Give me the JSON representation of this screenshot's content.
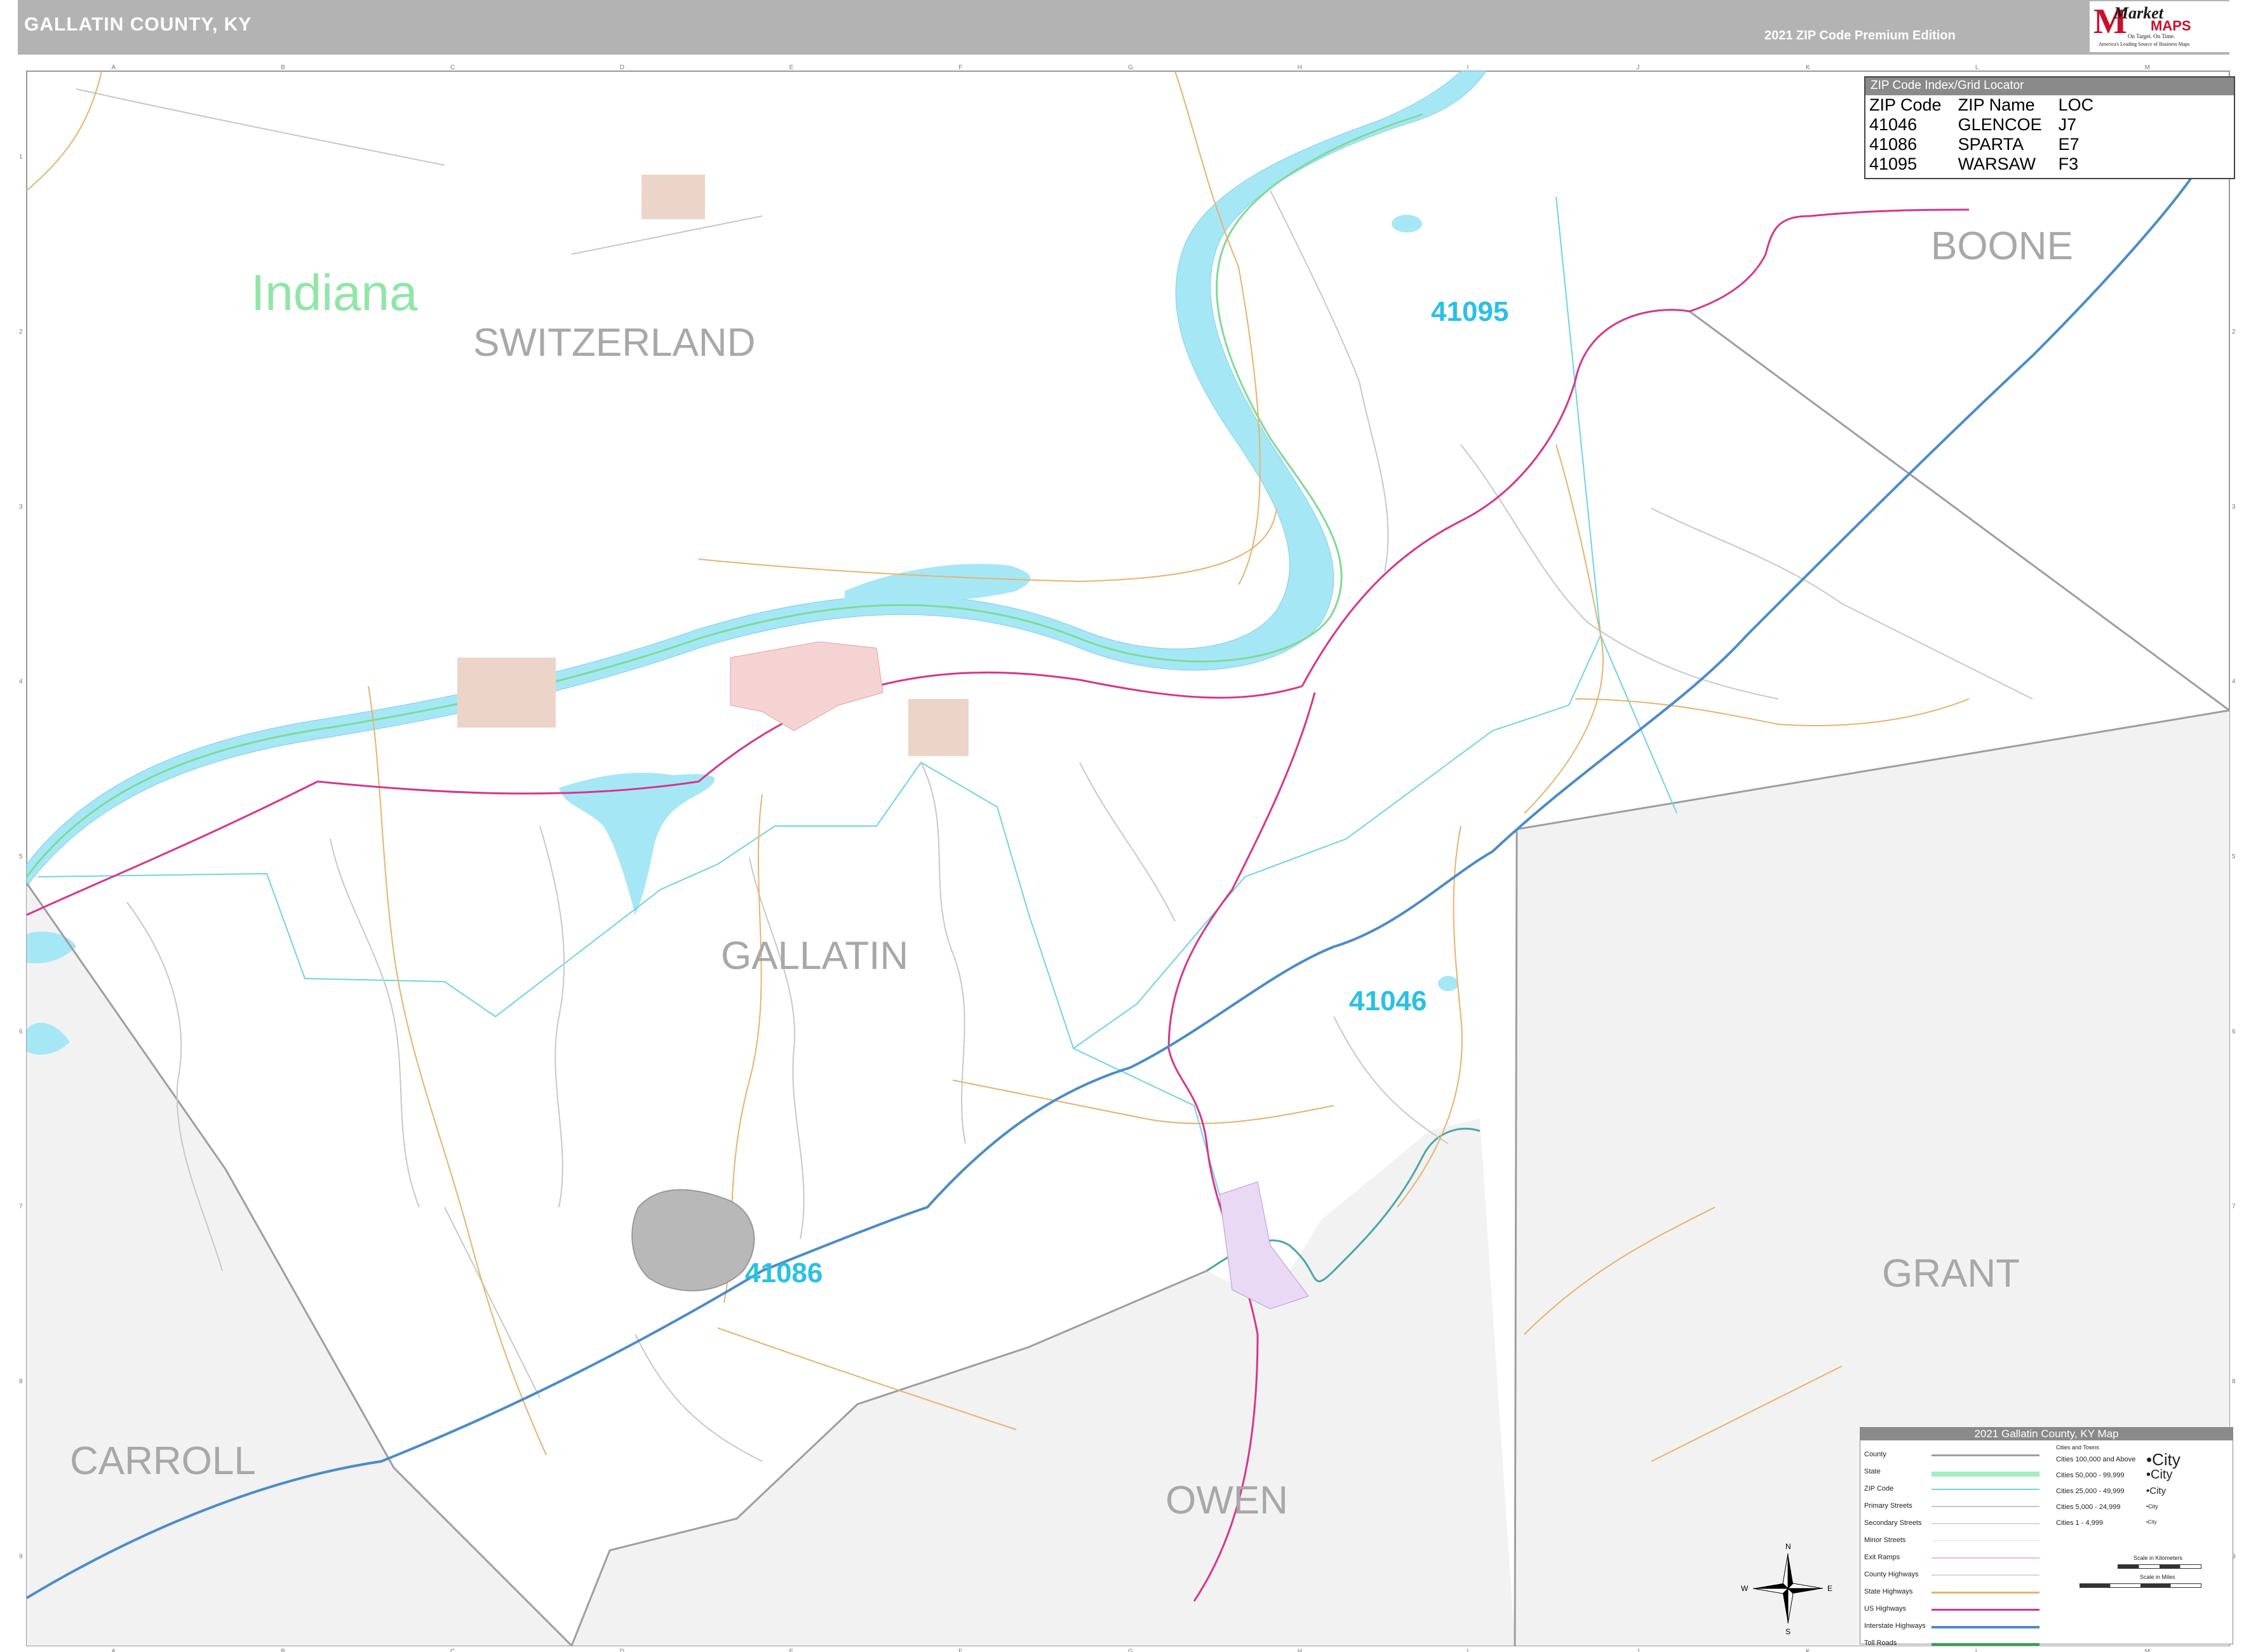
{
  "header": {
    "title": "GALLATIN COUNTY, KY",
    "edition": "2021 ZIP Code Premium Edition",
    "logo": {
      "market": "Market",
      "maps": "MAPS",
      "tagline1": "On Target. On Time.",
      "tagline2": "America's Leading Source of Business Maps"
    }
  },
  "map": {
    "grid_columns": [
      "A",
      "B",
      "C",
      "D",
      "E",
      "F",
      "G",
      "H",
      "I",
      "J",
      "K",
      "L",
      "M"
    ],
    "grid_rows": [
      "1",
      "2",
      "3",
      "4",
      "5",
      "6",
      "7",
      "8",
      "9"
    ],
    "state_label": "Indiana",
    "counties": [
      "SWITZERLAND",
      "BOONE",
      "GALLATIN",
      "GRANT",
      "CARROLL",
      "OWEN"
    ],
    "zips": [
      "41095",
      "41046",
      "41086"
    ],
    "colors": {
      "river": "#a6e7f6",
      "state_border": "#7ddb96",
      "us_highway": "#d6368a",
      "interstate": "#4c8cc8",
      "county_road": "#e7b26c",
      "zip_boundary": "#6fd3e8",
      "county_boundary": "#9e9e9e",
      "outside_fill": "#f2f2f2",
      "city_fill": "#f6d3d3"
    }
  },
  "zip_index": {
    "title": "ZIP Code Index/Grid Locator",
    "headers": [
      "ZIP Code",
      "ZIP Name",
      "LOC"
    ],
    "rows": [
      [
        "41046",
        "GLENCOE",
        "J7"
      ],
      [
        "41086",
        "SPARTA",
        "E7"
      ],
      [
        "41095",
        "WARSAW",
        "F3"
      ]
    ]
  },
  "legend": {
    "title": "2021 Gallatin County, KY Map",
    "items": [
      "County",
      "State",
      "ZIP Code",
      "Primary Streets",
      "Secondary Streets",
      "Minor Streets",
      "Exit Ramps",
      "County Highways",
      "State Highways",
      "US Highways",
      "Interstate Highways",
      "Toll Roads"
    ],
    "cities_header": "Cities and Towns",
    "city_classes": [
      "Cities 100,000 and Above",
      "Cities 50,000 - 99,999",
      "Cities 25,000 - 49,999",
      "Cities 5,000 - 24,999",
      "Cities 1 - 4,999"
    ],
    "city_sample": "City",
    "scale_km": "Scale in Kilometers",
    "scale_mi": "Scale in Miles"
  },
  "compass": {
    "n": "N",
    "s": "S",
    "e": "E",
    "w": "W"
  }
}
